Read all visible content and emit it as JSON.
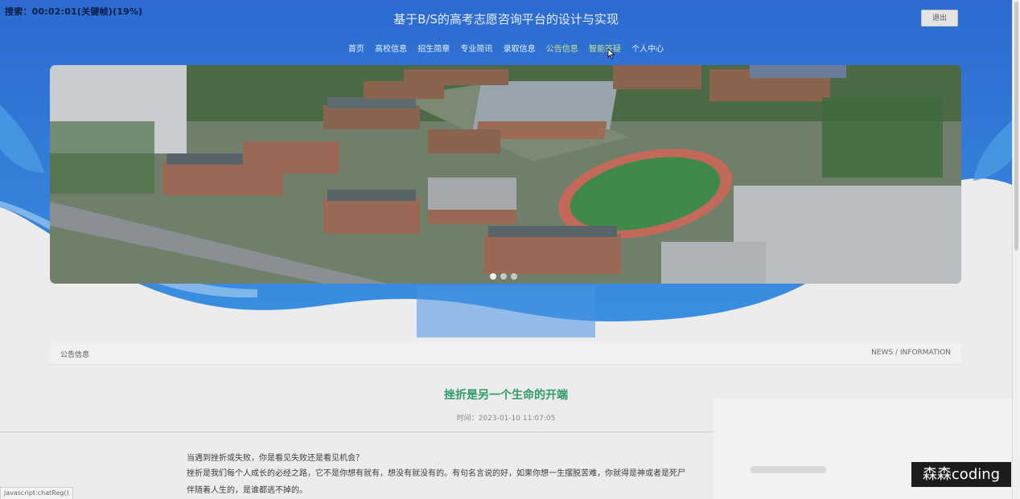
{
  "overlay": {
    "recording_label": "搜索：00:02:01(关键帧)(19%)",
    "watermark": "森森coding",
    "status_url": "javascript:chatReg()"
  },
  "header": {
    "title": "基于B/S的高考志愿咨询平台的设计与实现",
    "logout_label": "退出"
  },
  "nav": {
    "items": [
      {
        "label": "首页"
      },
      {
        "label": "高校信息"
      },
      {
        "label": "招生简章"
      },
      {
        "label": "专业简讯"
      },
      {
        "label": "录取信息"
      },
      {
        "label": "公告信息",
        "active": true
      },
      {
        "label": "智能答疑",
        "active": true
      },
      {
        "label": "个人中心"
      }
    ]
  },
  "carousel": {
    "slide_count": 3,
    "active_index": 0
  },
  "section": {
    "title": "公告信息",
    "subtitle": "NEWS / INFORMATION"
  },
  "article": {
    "title": "挫折是另一个生命的开端",
    "time": "时间：2023-01-10 11:07:05",
    "paragraphs": [
      "当遇到挫折或失败，你是看见失败还是看见机会？",
      "挫折是我们每个人成长的必经之路，它不是你想有就有，想没有就没有的。有句名言说的好，如果你想一生摆脱苦难，你就得是神或者是死尸",
      "伴随着人生的，是谁都逃不掉的。"
    ]
  },
  "colors": {
    "header_blue": "#2f6fd0",
    "accent_green": "#2f9a66",
    "nav_active": "#c8e08a"
  }
}
